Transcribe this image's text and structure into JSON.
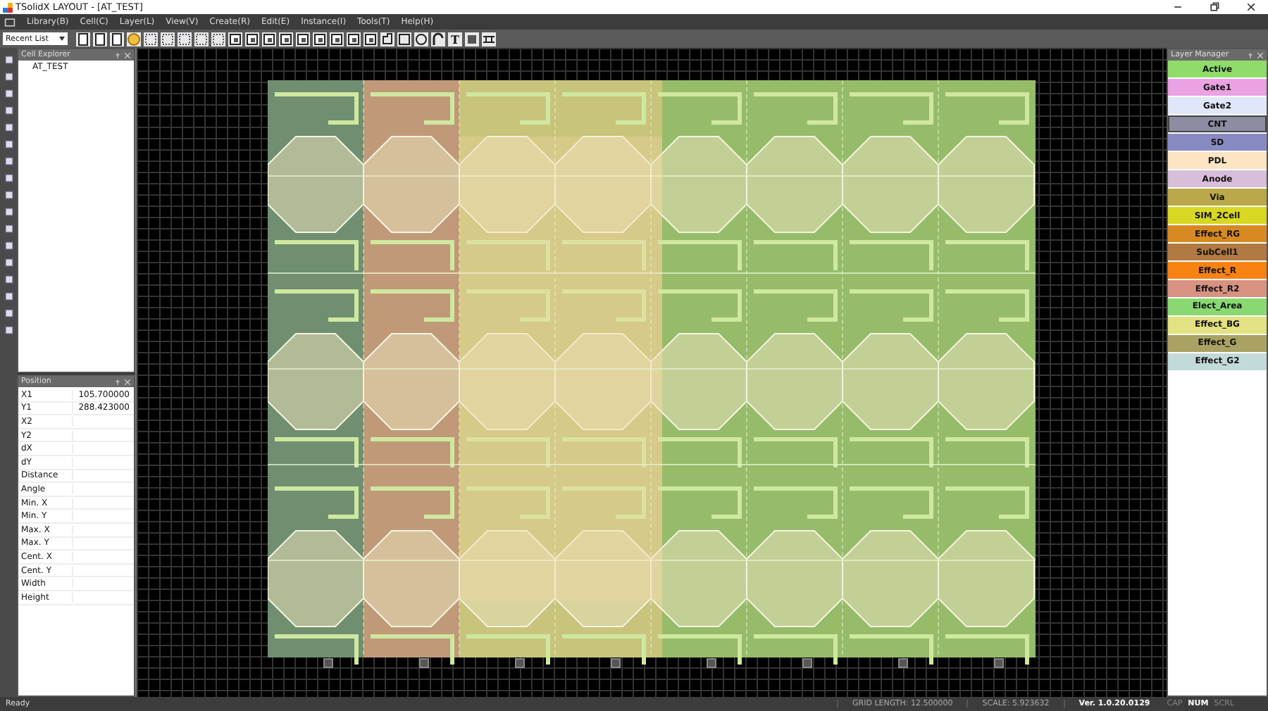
{
  "window": {
    "title": "TSolidX LAYOUT - [AT_TEST]"
  },
  "menu": [
    "Library(B)",
    "Cell(C)",
    "Layer(L)",
    "View(V)",
    "Create(R)",
    "Edit(E)",
    "Instance(I)",
    "Tools(T)",
    "Help(H)"
  ],
  "toolbar": {
    "dropdown": "Recent List",
    "text_tool": "T"
  },
  "cell_explorer": {
    "title": "Cell Explorer",
    "items": [
      {
        "label": "AT_TEST",
        "selected": false
      }
    ]
  },
  "position": {
    "title": "Position",
    "rows": [
      {
        "label": "X1",
        "value": "105.700000"
      },
      {
        "label": "Y1",
        "value": "288.423000"
      },
      {
        "label": "X2"
      },
      {
        "label": "Y2"
      },
      {
        "label": "dX"
      },
      {
        "label": "dY"
      },
      {
        "label": "Distance"
      },
      {
        "label": "Angle"
      },
      {
        "label": "Min. X"
      },
      {
        "label": "Min. Y"
      },
      {
        "label": "Max. X"
      },
      {
        "label": "Max. Y"
      },
      {
        "label": "Cent. X"
      },
      {
        "label": "Cent. Y"
      },
      {
        "label": "Width"
      },
      {
        "label": "Height"
      }
    ]
  },
  "layer_manager": {
    "title": "Layer Manager",
    "layers": [
      {
        "name": "Active",
        "color": "#8fdc6a",
        "selected": false
      },
      {
        "name": "Gate1",
        "color": "#eaa2e2",
        "selected": false
      },
      {
        "name": "Gate2",
        "color": "#dfe8fa",
        "selected": false
      },
      {
        "name": "CNT",
        "color": "#8c8ca2",
        "selected": true
      },
      {
        "name": "SD",
        "color": "#8a8ac2",
        "selected": false
      },
      {
        "name": "PDL",
        "color": "#fde4c2",
        "selected": false
      },
      {
        "name": "Anode",
        "color": "#d8bed8",
        "selected": false
      },
      {
        "name": "Via",
        "color": "#baa84a",
        "selected": false
      },
      {
        "name": "SIM_2Cell",
        "color": "#d8d822",
        "selected": false
      },
      {
        "name": "Effect_RG",
        "color": "#d88a22",
        "selected": false
      },
      {
        "name": "SubCell1",
        "color": "#b07a42",
        "selected": false
      },
      {
        "name": "Effect_R",
        "color": "#f88212",
        "selected": false
      },
      {
        "name": "Effect_R2",
        "color": "#d89282",
        "selected": false
      },
      {
        "name": "Elect_Area",
        "color": "#8ad872",
        "selected": false
      },
      {
        "name": "Effect_BG",
        "color": "#e2e282",
        "selected": false
      },
      {
        "name": "Effect_G",
        "color": "#aaa262",
        "selected": false
      },
      {
        "name": "Effect_G2",
        "color": "#c2dada",
        "selected": false
      }
    ]
  },
  "status_bar": {
    "message": "Ready",
    "grid_length": "GRID LENGTH: 12.500000",
    "scale": "SCALE: 5.923632",
    "version": "Ver. 1.0.20.0129",
    "indicators": [
      {
        "label": "CAP",
        "on": false
      },
      {
        "label": "NUM",
        "on": true
      },
      {
        "label": "SCRL",
        "on": false
      }
    ]
  }
}
